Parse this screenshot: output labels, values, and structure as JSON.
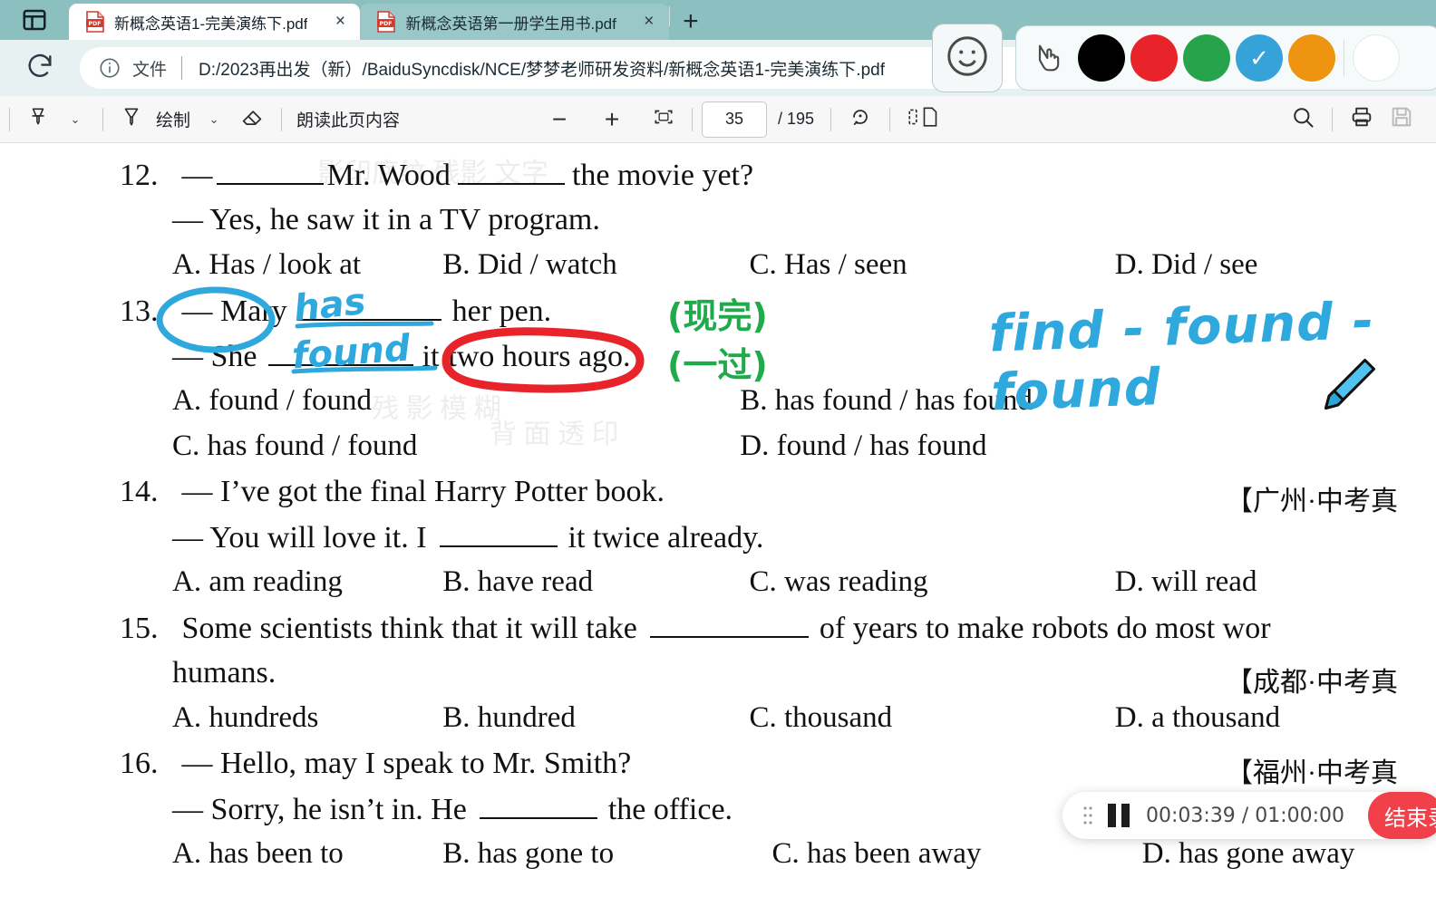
{
  "browser": {
    "sidebar_icon": "tab-layout-icon",
    "tabs": [
      {
        "title": "新概念英语1-完美演练下.pdf",
        "icon": "pdf-file-icon",
        "close": "×",
        "active": true
      },
      {
        "title": "新概念英语第一册学生用书.pdf",
        "icon": "pdf-file-icon",
        "close": "×",
        "active": false
      }
    ],
    "new_tab_label": "+",
    "reload_icon": "reload-icon",
    "omnibox": {
      "info_icon": "info-circle-icon",
      "scheme_label": "文件",
      "url": "D:/2023再出发（新）/BaiduSyncdisk/NCE/梦梦老师研发资料/新概念英语1-完美演练下.pdf"
    }
  },
  "pdf_toolbar": {
    "highlight_icon": "highlighter-icon",
    "highlight_caret": "⌄",
    "draw_icon": "pen-icon",
    "draw_label": "绘制",
    "draw_caret": "⌄",
    "eraser_icon": "eraser-icon",
    "read_aloud_label": "朗读此页内容",
    "zoom_out": "−",
    "zoom_in": "+",
    "fit_page_icon": "fit-page-icon",
    "page_current": "35",
    "page_total": "/ 195",
    "rotate_icon": "rotate-icon",
    "layout_icon": "page-layout-icon",
    "search_icon": "search-icon",
    "print_icon": "print-icon",
    "save_icon": "save-icon"
  },
  "overlay": {
    "smiley_icon": "smiley-face-icon",
    "cursor_icon": "hand-cursor-icon",
    "colors": [
      {
        "name": "black",
        "hex": "#000000",
        "selected": false
      },
      {
        "name": "red",
        "hex": "#e8232a",
        "selected": false
      },
      {
        "name": "green",
        "hex": "#27a44b",
        "selected": false
      },
      {
        "name": "blue",
        "hex": "#35a3d8",
        "selected": true
      },
      {
        "name": "orange",
        "hex": "#ef9410",
        "selected": false
      },
      {
        "name": "white",
        "hex": "#ffffff",
        "selected": false
      }
    ],
    "selected_check": "✓"
  },
  "recorder": {
    "drag_handle_icon": "drag-dots-icon",
    "pause_icon": "pause-icon",
    "elapsed": "00:03:39",
    "separator": "/",
    "total": "01:00:00",
    "time_display": "00:03:39 / 01:00:00",
    "stop_label": "结束录"
  },
  "document": {
    "questions": [
      {
        "num": "12.",
        "lines": [
          {
            "pre": "— ",
            "blank1": true,
            "mid": " Mr. Wood ",
            "blank2": true,
            "post": " the movie yet?"
          },
          {
            "text": "— Yes, he saw it in a TV program."
          }
        ],
        "options": [
          "A. Has / look at",
          "B. Did / watch",
          "C. Has / seen",
          "D. Did / see"
        ]
      },
      {
        "num": "13.",
        "lines": [
          {
            "text": "— Mary",
            "blank": true,
            "post": " her pen."
          },
          {
            "text": "— She",
            "blank": true,
            "post": " it two hours ago."
          }
        ],
        "options": [
          "A. found / found",
          "B. has found / has found",
          "C. has found / found",
          "D. found / has found"
        ]
      },
      {
        "num": "14.",
        "lines": [
          {
            "text": "— I’ve got the final Harry Potter book."
          },
          {
            "text": "— You will love it. I ",
            "blank": true,
            "post": " it twice already."
          }
        ],
        "options": [
          "A. am reading",
          "B. have read",
          "C. was reading",
          "D. will read"
        ],
        "city_tag": "【广州·中考真"
      },
      {
        "num": "15.",
        "lines": [
          {
            "text": "Some scientists think that it will take ",
            "blank": true,
            "post": " of years to make robots do most wor"
          },
          {
            "text": "humans."
          }
        ],
        "options": [
          "A. hundreds",
          "B. hundred",
          "C. thousand",
          "D. a thousand"
        ],
        "city_tag": "【成都·中考真"
      },
      {
        "num": "16.",
        "lines": [
          {
            "text": "— Hello, may I speak to Mr. Smith?"
          },
          {
            "text": "— Sorry, he isn’t in. He ",
            "blank": true,
            "post": " the office."
          }
        ],
        "options": [
          "A. has been to",
          "B. has gone to",
          "C. has been away",
          "D. has gone away"
        ],
        "city_tag": "【福州·中考真"
      }
    ],
    "q12_line1_pre": "—",
    "q12_line1_mid": "Mr. Wood",
    "q12_line1_post": "the movie yet?",
    "q12_line2": "— Yes, he saw it in a TV program.",
    "q12_opt_a": "A. Has / look at",
    "q12_opt_b": "B. Did / watch",
    "q12_opt_c": "C. Has / seen",
    "q12_opt_d": "D. Did / see",
    "q13_line1_pre": "— Mary",
    "q13_line1_post": "her pen.",
    "q13_line2_pre": "— She",
    "q13_line2_mid": "it",
    "q13_line2_circled": "two hours ago.",
    "q13_opt_a": "A. found / found",
    "q13_opt_b": "B. has found / has found",
    "q13_opt_c": "C. has found / found",
    "q13_opt_d": "D. found / has found",
    "q14_line1": "— I’ve got the final Harry Potter book.",
    "q14_line2_pre": "— You will love it. I",
    "q14_line2_post": "it twice already.",
    "q14_opt_a": "A. am reading",
    "q14_opt_b": "B. have read",
    "q14_opt_c": "C. was reading",
    "q14_opt_d": "D. will read",
    "q14_city": "【广州·中考真",
    "q15_line1_pre": "Some scientists think that it will take",
    "q15_line1_post": "of years to make robots do most wor",
    "q15_line2": "humans.",
    "q15_opt_a": "A. hundreds",
    "q15_opt_b": "B. hundred",
    "q15_opt_c": "C. thousand",
    "q15_opt_d": "D. a thousand",
    "q15_city": "【成都·中考真",
    "q16_line1": "— Hello, may I speak to Mr. Smith?",
    "q16_line2_pre": "— Sorry, he isn’t in. He",
    "q16_line2_post": "the office.",
    "q16_opt_a": "A. has been to",
    "q16_opt_b": "B. has gone to",
    "q16_opt_c": "C. has been away",
    "q16_opt_d": "D. has gone away",
    "q16_city": "【福州·中考真",
    "num12": "12.",
    "num13": "13.",
    "num14": "14.",
    "num15": "15.",
    "num16": "16."
  },
  "annotations": {
    "ink_has": "has",
    "ink_found": "found",
    "ink_verb_forms": "find - found - found",
    "note_present_perfect": "(现完)",
    "note_simple_past": "(一过)",
    "circle_mary": "blue-ellipse-around-mary",
    "oval_two_hours_ago": "red-oval-around-two-hours-ago",
    "pen_cursor": "blue-pen-cursor"
  }
}
